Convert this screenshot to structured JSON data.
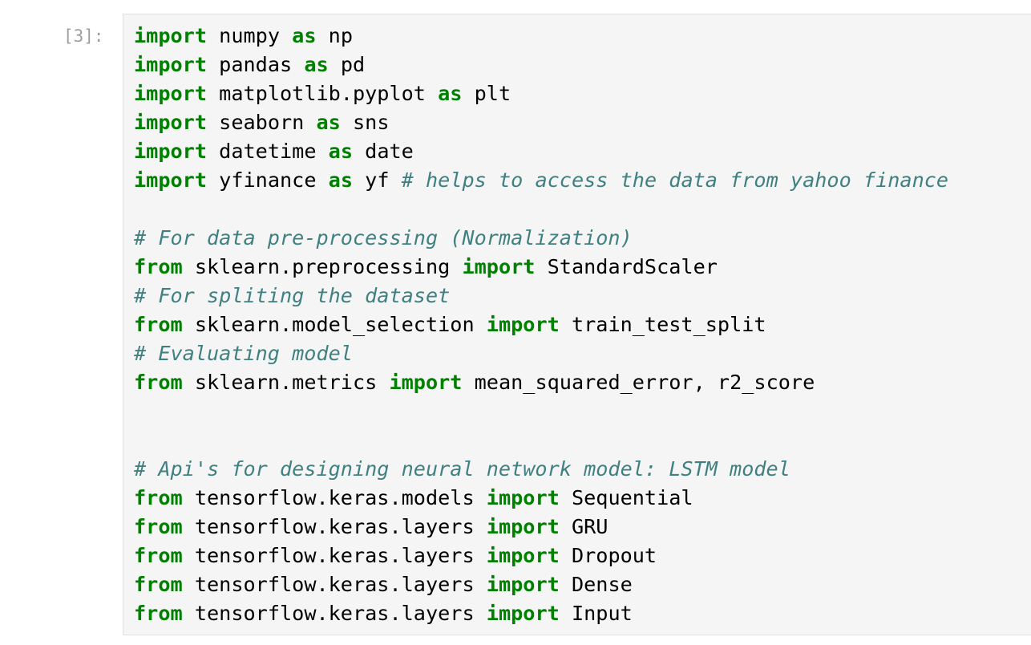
{
  "cell": {
    "prompt": "[3]:",
    "lines": [
      [
        {
          "t": "kw",
          "v": "import"
        },
        {
          "t": "tx",
          "v": " numpy "
        },
        {
          "t": "kw",
          "v": "as"
        },
        {
          "t": "tx",
          "v": " np"
        }
      ],
      [
        {
          "t": "kw",
          "v": "import"
        },
        {
          "t": "tx",
          "v": " pandas "
        },
        {
          "t": "kw",
          "v": "as"
        },
        {
          "t": "tx",
          "v": " pd"
        }
      ],
      [
        {
          "t": "kw",
          "v": "import"
        },
        {
          "t": "tx",
          "v": " matplotlib.pyplot "
        },
        {
          "t": "kw",
          "v": "as"
        },
        {
          "t": "tx",
          "v": " plt"
        }
      ],
      [
        {
          "t": "kw",
          "v": "import"
        },
        {
          "t": "tx",
          "v": " seaborn "
        },
        {
          "t": "kw",
          "v": "as"
        },
        {
          "t": "tx",
          "v": " sns"
        }
      ],
      [
        {
          "t": "kw",
          "v": "import"
        },
        {
          "t": "tx",
          "v": " datetime "
        },
        {
          "t": "kw",
          "v": "as"
        },
        {
          "t": "tx",
          "v": " date"
        }
      ],
      [
        {
          "t": "kw",
          "v": "import"
        },
        {
          "t": "tx",
          "v": " yfinance "
        },
        {
          "t": "kw",
          "v": "as"
        },
        {
          "t": "tx",
          "v": " yf "
        },
        {
          "t": "cm",
          "v": "# helps to access the data from yahoo finance"
        }
      ],
      [],
      [
        {
          "t": "cm",
          "v": "# For data pre-processing (Normalization)"
        }
      ],
      [
        {
          "t": "kw",
          "v": "from"
        },
        {
          "t": "tx",
          "v": " sklearn.preprocessing "
        },
        {
          "t": "kw",
          "v": "import"
        },
        {
          "t": "tx",
          "v": " StandardScaler"
        }
      ],
      [
        {
          "t": "cm",
          "v": "# For spliting the dataset"
        }
      ],
      [
        {
          "t": "kw",
          "v": "from"
        },
        {
          "t": "tx",
          "v": " sklearn.model_selection "
        },
        {
          "t": "kw",
          "v": "import"
        },
        {
          "t": "tx",
          "v": " train_test_split"
        }
      ],
      [
        {
          "t": "cm",
          "v": "# Evaluating model"
        }
      ],
      [
        {
          "t": "kw",
          "v": "from"
        },
        {
          "t": "tx",
          "v": " sklearn.metrics "
        },
        {
          "t": "kw",
          "v": "import"
        },
        {
          "t": "tx",
          "v": " mean_squared_error, r2_score"
        }
      ],
      [],
      [],
      [
        {
          "t": "cm",
          "v": "# Api's for designing neural network model: LSTM model"
        }
      ],
      [
        {
          "t": "kw",
          "v": "from"
        },
        {
          "t": "tx",
          "v": " tensorflow.keras.models "
        },
        {
          "t": "kw",
          "v": "import"
        },
        {
          "t": "tx",
          "v": " Sequential"
        }
      ],
      [
        {
          "t": "kw",
          "v": "from"
        },
        {
          "t": "tx",
          "v": " tensorflow.keras.layers "
        },
        {
          "t": "kw",
          "v": "import"
        },
        {
          "t": "tx",
          "v": " GRU"
        }
      ],
      [
        {
          "t": "kw",
          "v": "from"
        },
        {
          "t": "tx",
          "v": " tensorflow.keras.layers "
        },
        {
          "t": "kw",
          "v": "import"
        },
        {
          "t": "tx",
          "v": " Dropout"
        }
      ],
      [
        {
          "t": "kw",
          "v": "from"
        },
        {
          "t": "tx",
          "v": " tensorflow.keras.layers "
        },
        {
          "t": "kw",
          "v": "import"
        },
        {
          "t": "tx",
          "v": " Dense"
        }
      ],
      [
        {
          "t": "kw",
          "v": "from"
        },
        {
          "t": "tx",
          "v": " tensorflow.keras.layers "
        },
        {
          "t": "kw",
          "v": "import"
        },
        {
          "t": "tx",
          "v": " Input"
        }
      ]
    ]
  },
  "colors": {
    "keyword": "#008000",
    "comment": "#408080",
    "prompt": "#9e9e9e",
    "cell_background": "#f5f5f5",
    "cell_border": "#e0e0e0"
  }
}
